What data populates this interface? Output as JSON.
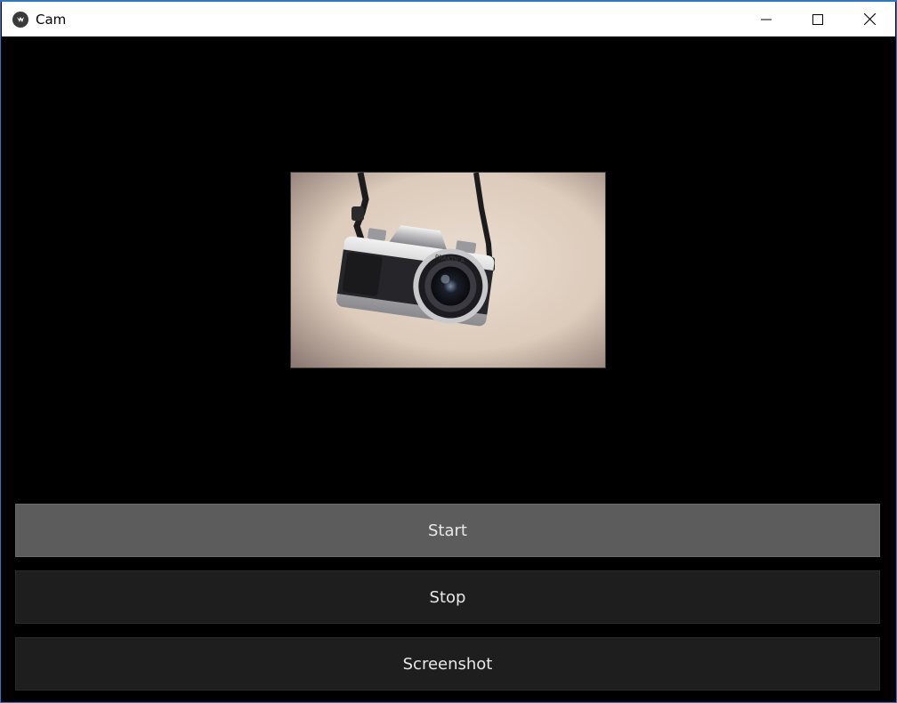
{
  "window": {
    "title": "Cam",
    "controls": [
      "minimize-icon",
      "maximize-icon",
      "close-icon"
    ]
  },
  "preview": {
    "content": "camera-photo-frame"
  },
  "buttons": {
    "start_label": "Start",
    "stop_label": "Stop",
    "screenshot_label": "Screenshot"
  },
  "colors": {
    "active_button": "#5c5c5c",
    "inactive_button": "#1e1e1e",
    "background": "#000000"
  }
}
